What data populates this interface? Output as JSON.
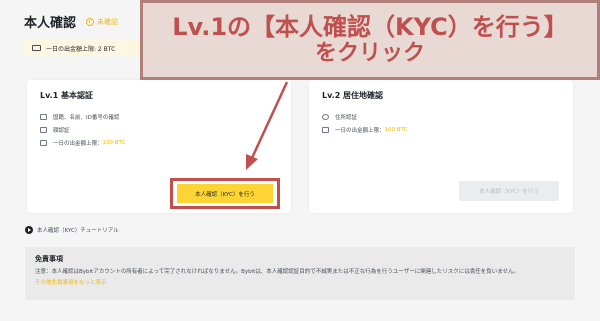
{
  "header": {
    "title": "本人確認",
    "status": "未確認"
  },
  "limit_bar": {
    "text": "一日の出金額上限: 2 BTC"
  },
  "level1": {
    "title": "Lv.1 基本認証",
    "requirements": [
      {
        "icon": "id-card-icon",
        "text": "国籍、名前、ID番号の確認"
      },
      {
        "icon": "face-icon",
        "text": "顔認証"
      }
    ],
    "limit_label": "一日の出金額上限：",
    "limit_value": "100 BTC",
    "button_label": "本人確認（KYC）を行う"
  },
  "level2": {
    "title": "Lv.2 居住地確認",
    "requirements": [
      {
        "icon": "location-icon",
        "text": "住所認証"
      }
    ],
    "limit_label": "一日の出金額上限：",
    "limit_value": "100 BTC",
    "button_label": "本人確認（KYC）を行う"
  },
  "tutorial": {
    "label": "本人確認（KYC）チュートリアル"
  },
  "disclaimer": {
    "title": "免責事項",
    "text": "注意：本人確認はBybitアカウントの所有者によって完了されなければなりません。Bybitは、本人確認認証目的で不誠実または不正な行為を行うユーザーに関連したリスクには責任を負いません。",
    "link": "その他免責事項をもっと表示"
  },
  "callout": {
    "line1": "Lv.1の【本人確認（KYC）を行う】",
    "line2": "をクリック"
  },
  "colors": {
    "accent": "#fcd535",
    "status": "#f0b90b",
    "highlight": "#c0504d",
    "callout_bg": "#e8d9d5"
  }
}
